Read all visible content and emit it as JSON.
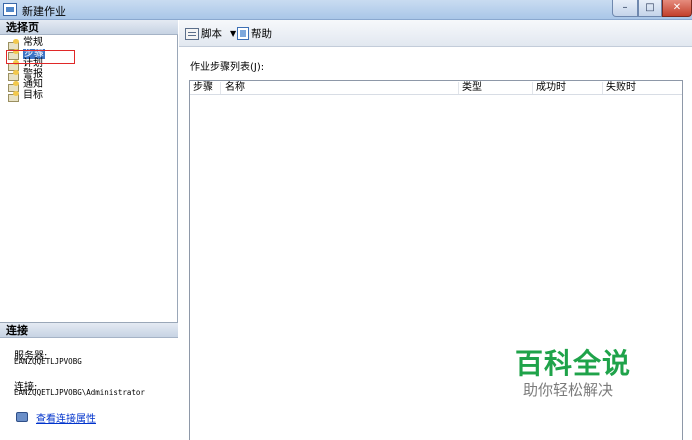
{
  "window": {
    "title": "新建作业",
    "minimize": "–",
    "maximize": "□",
    "close": "✕"
  },
  "left": {
    "select_page_header": "选择页",
    "nav_items": [
      {
        "label": "常规"
      },
      {
        "label": "步骤"
      },
      {
        "label": "计划"
      },
      {
        "label": "警报"
      },
      {
        "label": "通知"
      },
      {
        "label": "目标"
      }
    ],
    "selected_index": 1,
    "connection": {
      "header": "连接",
      "server_label": "服务器:",
      "server_value": "EANZQQETLJPVOBG",
      "conn_label": "连接:",
      "conn_value": "EANZQQETLJPVOBG\\Administrator",
      "link_text": "查看连接属性"
    }
  },
  "toolbar": {
    "script_label": "脚本",
    "dropdown": "▼",
    "help_label": "帮助"
  },
  "main": {
    "list_caption": "作业步骤列表(J):",
    "columns": [
      "步骤",
      "名称",
      "类型",
      "成功时",
      "失败时"
    ]
  },
  "watermark": {
    "main": "百科全说",
    "sub": "助你轻松解决"
  },
  "colors": {
    "selection": "#3b74c6",
    "highlight_box": "#e02828",
    "link": "#0033cc",
    "watermark_green": "#1fa34a"
  }
}
